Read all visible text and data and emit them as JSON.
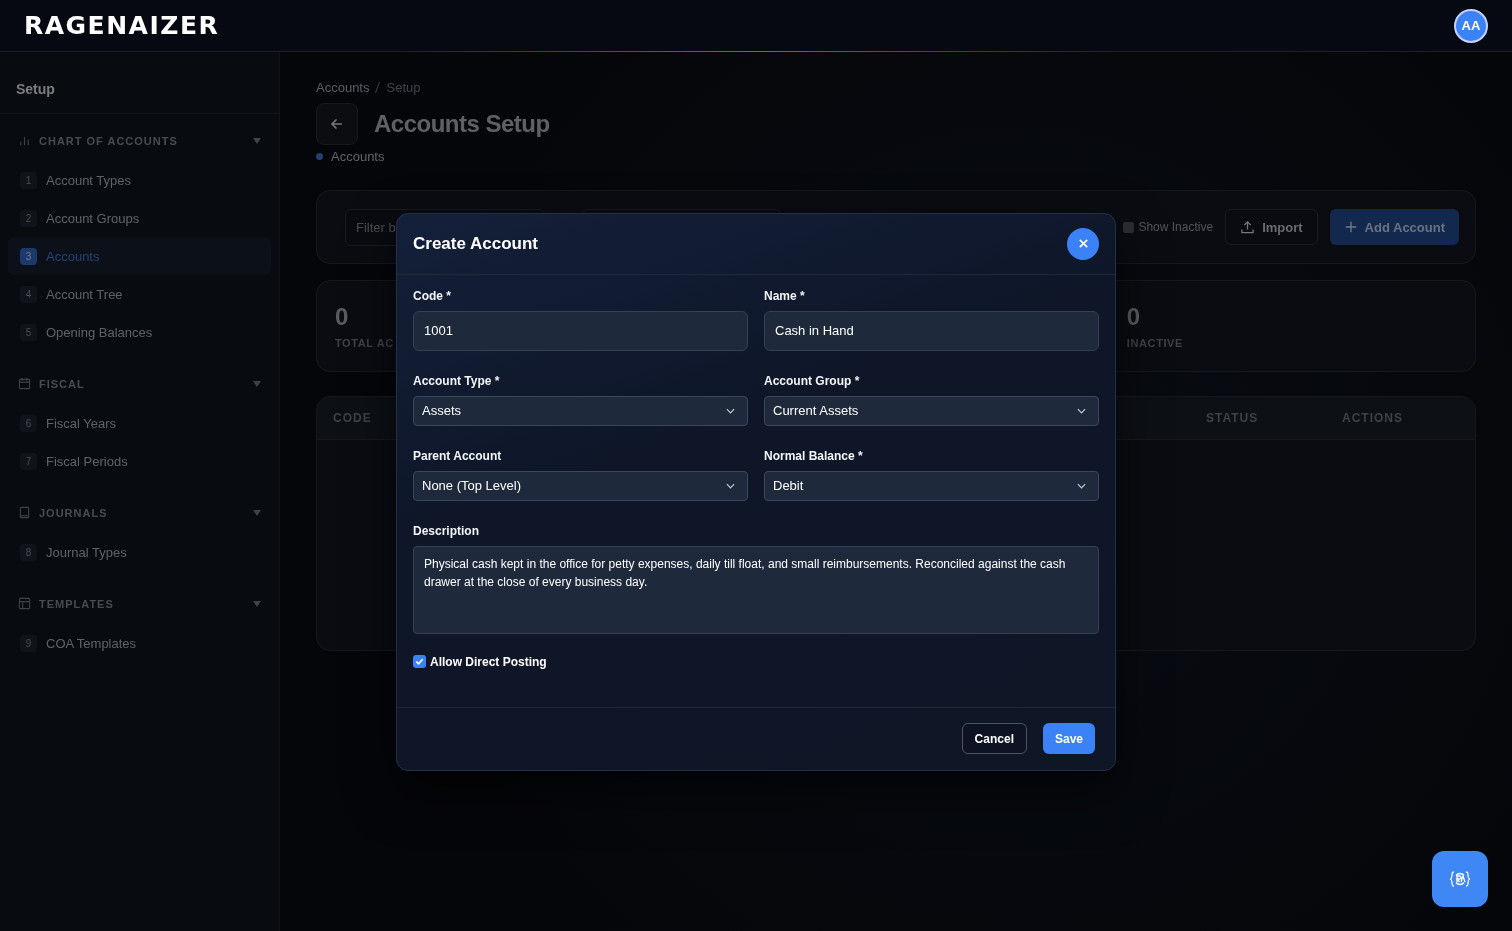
{
  "app": {
    "logo": "RAGENAIZER",
    "avatar": "AA"
  },
  "sidebar": {
    "title": "Setup",
    "sections": [
      {
        "label": "CHART OF ACCOUNTS",
        "expanded": true,
        "items": [
          {
            "number": "1",
            "label": "Account Types",
            "selected": false
          },
          {
            "number": "2",
            "label": "Account Groups",
            "selected": false
          },
          {
            "number": "3",
            "label": "Accounts",
            "selected": true
          },
          {
            "number": "4",
            "label": "Account Tree",
            "selected": false
          },
          {
            "number": "5",
            "label": "Opening Balances",
            "selected": false
          }
        ]
      },
      {
        "label": "FISCAL",
        "expanded": true,
        "items": [
          {
            "number": "6",
            "label": "Fiscal Years",
            "selected": false
          },
          {
            "number": "7",
            "label": "Fiscal Periods",
            "selected": false
          }
        ]
      },
      {
        "label": "JOURNALS",
        "expanded": true,
        "items": [
          {
            "number": "8",
            "label": "Journal Types",
            "selected": false
          }
        ]
      },
      {
        "label": "TEMPLATES",
        "expanded": true,
        "items": [
          {
            "number": "9",
            "label": "COA Templates",
            "selected": false
          }
        ]
      }
    ]
  },
  "page": {
    "breadcrumb": [
      "Accounts",
      "Setup"
    ],
    "title": "Accounts Setup",
    "subtitle": "Accounts"
  },
  "toolbar": {
    "filter_placeholder": "Filter b",
    "show_inactive": {
      "label": "Show Inactive",
      "checked": false
    },
    "buttons": [
      {
        "label": "Import",
        "kind": "secondary"
      },
      {
        "label": "Add Account",
        "kind": "primary"
      }
    ]
  },
  "stats": [
    {
      "value": "0",
      "label": "TOTAL AC"
    },
    {
      "value": "0",
      "label": "INACTIVE"
    }
  ],
  "table": {
    "columns": [
      "CODE",
      "STATUS",
      "ACTIONS"
    ]
  },
  "dialog": {
    "title": "Create Account",
    "fields": [
      {
        "label": "Code *",
        "kind": "text",
        "value": "1001"
      },
      {
        "label": "Name *",
        "kind": "text",
        "value": "Cash in Hand"
      },
      {
        "label": "Account Type *",
        "kind": "select",
        "value": "Assets"
      },
      {
        "label": "Account Group *",
        "kind": "select",
        "value": "Current Assets"
      },
      {
        "label": "Parent Account",
        "kind": "select",
        "value": "None (Top Level)"
      },
      {
        "label": "Normal Balance *",
        "kind": "select",
        "value": "Debit"
      },
      {
        "label": "Description",
        "kind": "textarea",
        "value": "Physical cash kept in the office for petty expenses, daily till float, and small reimbursements. Reconciled against the cash drawer at the close of every business day."
      }
    ],
    "allow_direct_posting": {
      "label": "Allow Direct Posting",
      "checked": true
    },
    "buttons": [
      {
        "label": "Cancel",
        "kind": "secondary"
      },
      {
        "label": "Save",
        "kind": "primary"
      }
    ]
  }
}
